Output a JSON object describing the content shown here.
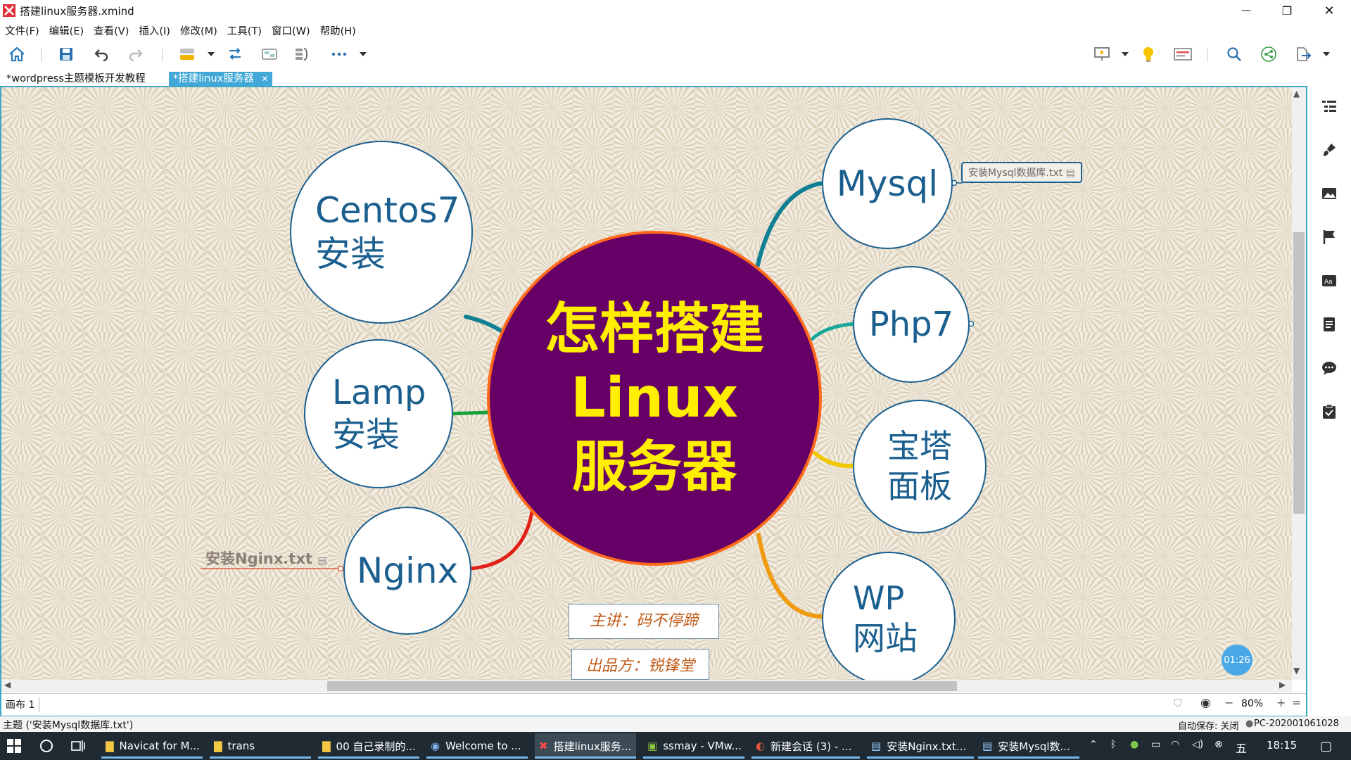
{
  "window": {
    "title": "搭建linux服务器.xmind",
    "minimize_label": "—",
    "maximize_label": "❐",
    "close_label": "✕"
  },
  "menu": [
    "文件(F)",
    "编辑(E)",
    "查看(V)",
    "插入(I)",
    "修改(M)",
    "工具(T)",
    "窗口(W)",
    "帮助(H)"
  ],
  "tabs": [
    {
      "label": "*wordpress主题模板开发教程",
      "active": false
    },
    {
      "label": "*搭建linux服务器",
      "active": true,
      "close": "✕"
    }
  ],
  "mindmap": {
    "central": [
      "怎样搭建",
      "Linux",
      "服务器"
    ],
    "topics": {
      "centos": [
        "Centos7",
        "安装"
      ],
      "lamp": [
        "Lamp",
        "安装"
      ],
      "nginx": [
        "Nginx"
      ],
      "mysql": [
        "Mysql"
      ],
      "php": [
        "Php7"
      ],
      "baota": [
        "宝塔",
        "面板"
      ],
      "wp": [
        "WP",
        "网站"
      ]
    },
    "nginx_note": "安装Nginx.txt",
    "mysql_note": "安装Mysql数据库.txt",
    "presenter": "主讲：码不停蹄",
    "producer": "出品方：锐锋堂"
  },
  "timer_badge": "01:26",
  "sheet": {
    "name": "画布 1",
    "zoom": "80%",
    "zoom_minus": "−",
    "zoom_plus": "+",
    "zoom_reset": "="
  },
  "status": {
    "left": "主题 ('安装Mysql数据库.txt')",
    "autosave": "自动保存: 关闭",
    "host": "PC-202001061028"
  },
  "taskbar": {
    "items": [
      {
        "label": "Navicat for M..."
      },
      {
        "label": "trans"
      },
      {
        "label": "00 自己录制的..."
      },
      {
        "label": "Welcome to ..."
      },
      {
        "label": "搭建linux服务..."
      },
      {
        "label": "ssmay - VMw..."
      },
      {
        "label": "新建会话 (3) - ..."
      },
      {
        "label": "安装Nginx.txt..."
      },
      {
        "label": "安装Mysql数..."
      }
    ],
    "clock": "18:15",
    "ime": "五"
  },
  "colors": {
    "accent": "#3fa9c5",
    "central_fill": "#660066",
    "central_text": "#ffee00",
    "central_border": "#ff6a1a",
    "topic_text": "#1b5f8f"
  }
}
